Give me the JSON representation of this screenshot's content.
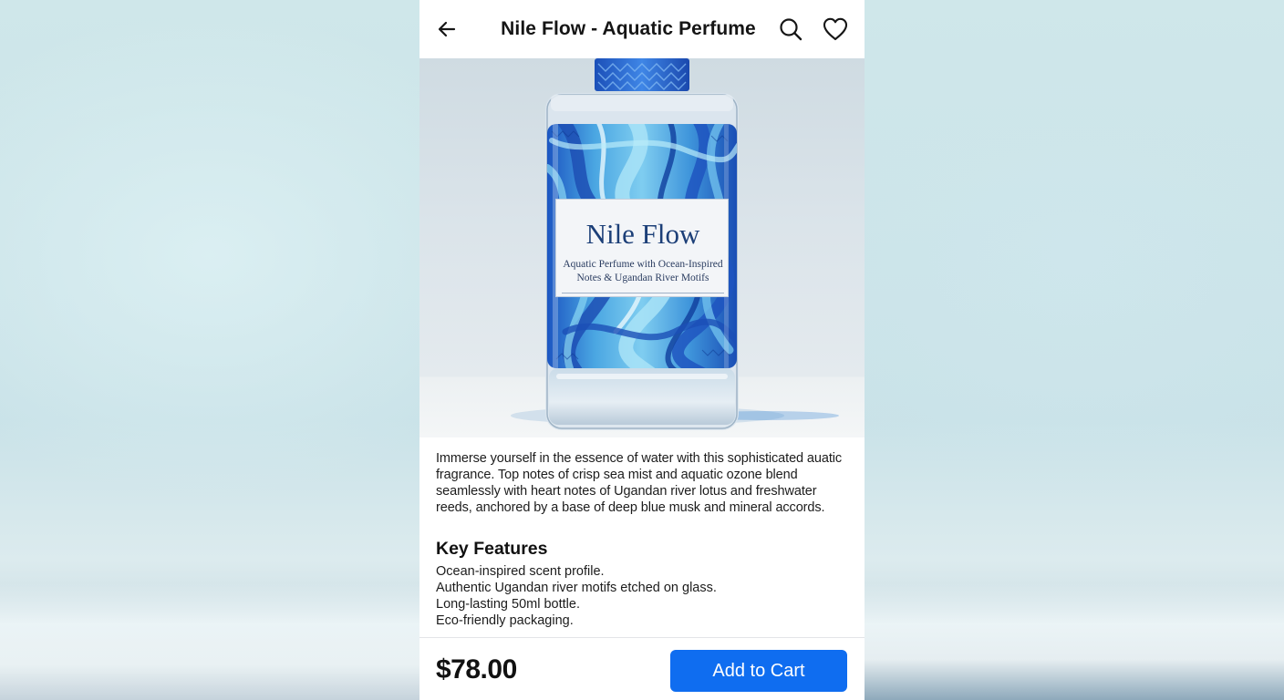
{
  "header": {
    "title": "Nile Flow - Aquatic Perfume",
    "back_icon": "arrow-left-icon",
    "search_icon": "search-icon",
    "favorite_icon": "heart-icon"
  },
  "product_image": {
    "label_title": "Nile Flow",
    "label_subtitle": "Aquatic Perfume with Ocean-Inspired Notes & Ugandan River Motifs"
  },
  "description": "Immerse yourself in the essence of water with this sophisticated auatic fragrance. Top notes of crisp sea mist and aquatic ozone blend seamlessly with heart notes of Ugandan river lotus and freshwater reeds, anchored by a base of deep blue musk and mineral accords.",
  "features": {
    "heading": "Key Features",
    "items": [
      "Ocean-inspired scent profile.",
      "Authentic Ugandan river motifs etched on glass.",
      "Long-lasting 50ml bottle.",
      "Eco-friendly packaging."
    ]
  },
  "footer": {
    "price": "$78.00",
    "add_to_cart_label": "Add to Cart"
  },
  "colors": {
    "accent": "#0f6df0",
    "label_text": "#1c3f78",
    "bottle_blue": "#1f5fc4",
    "bottle_light": "#6fc0e8"
  }
}
